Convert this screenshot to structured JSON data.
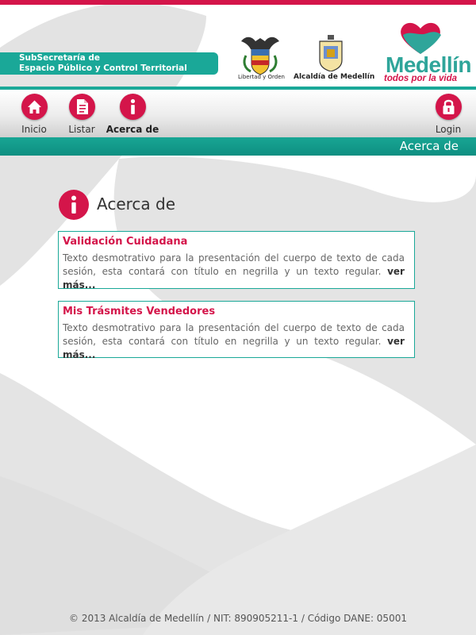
{
  "header": {
    "department_line1": "SubSecretaría de",
    "department_line2": "Espacio Público y Control Territorial",
    "logos": {
      "shield_caption": "Libertad y Orden",
      "alcaldia_caption": "Alcaldía de Medellín",
      "medellin_word": "Medellín",
      "medellin_slogan": "todos por la vida"
    }
  },
  "nav": {
    "items": [
      {
        "label": "Inicio",
        "icon": "home-icon"
      },
      {
        "label": "Listar",
        "icon": "document-list-icon"
      },
      {
        "label": "Acerca de",
        "icon": "info-icon",
        "active": true
      }
    ],
    "login": {
      "label": "Login",
      "icon": "lock-icon"
    }
  },
  "title_strip": "Acerca de",
  "main": {
    "heading": "Acerca de",
    "cards": [
      {
        "title": "Validación Cuidadana",
        "body": "Texto desmotrativo para la presentación del cuerpo de texto de cada sesión, esta contará con título en negrilla y un texto regular.",
        "more": "ver más..."
      },
      {
        "title": "Mis Trásmites Vendedores",
        "body": "Texto desmotrativo para la presentación del cuerpo de texto de cada sesión, esta contará con título en negrilla y un texto regular.",
        "more": "ver más..."
      }
    ]
  },
  "footer": "© 2013 Alcaldía de Medellín / NIT: 890905211-1 / Código DANE: 05001",
  "colors": {
    "accent_red": "#d4154a",
    "accent_teal": "#1aa898"
  }
}
